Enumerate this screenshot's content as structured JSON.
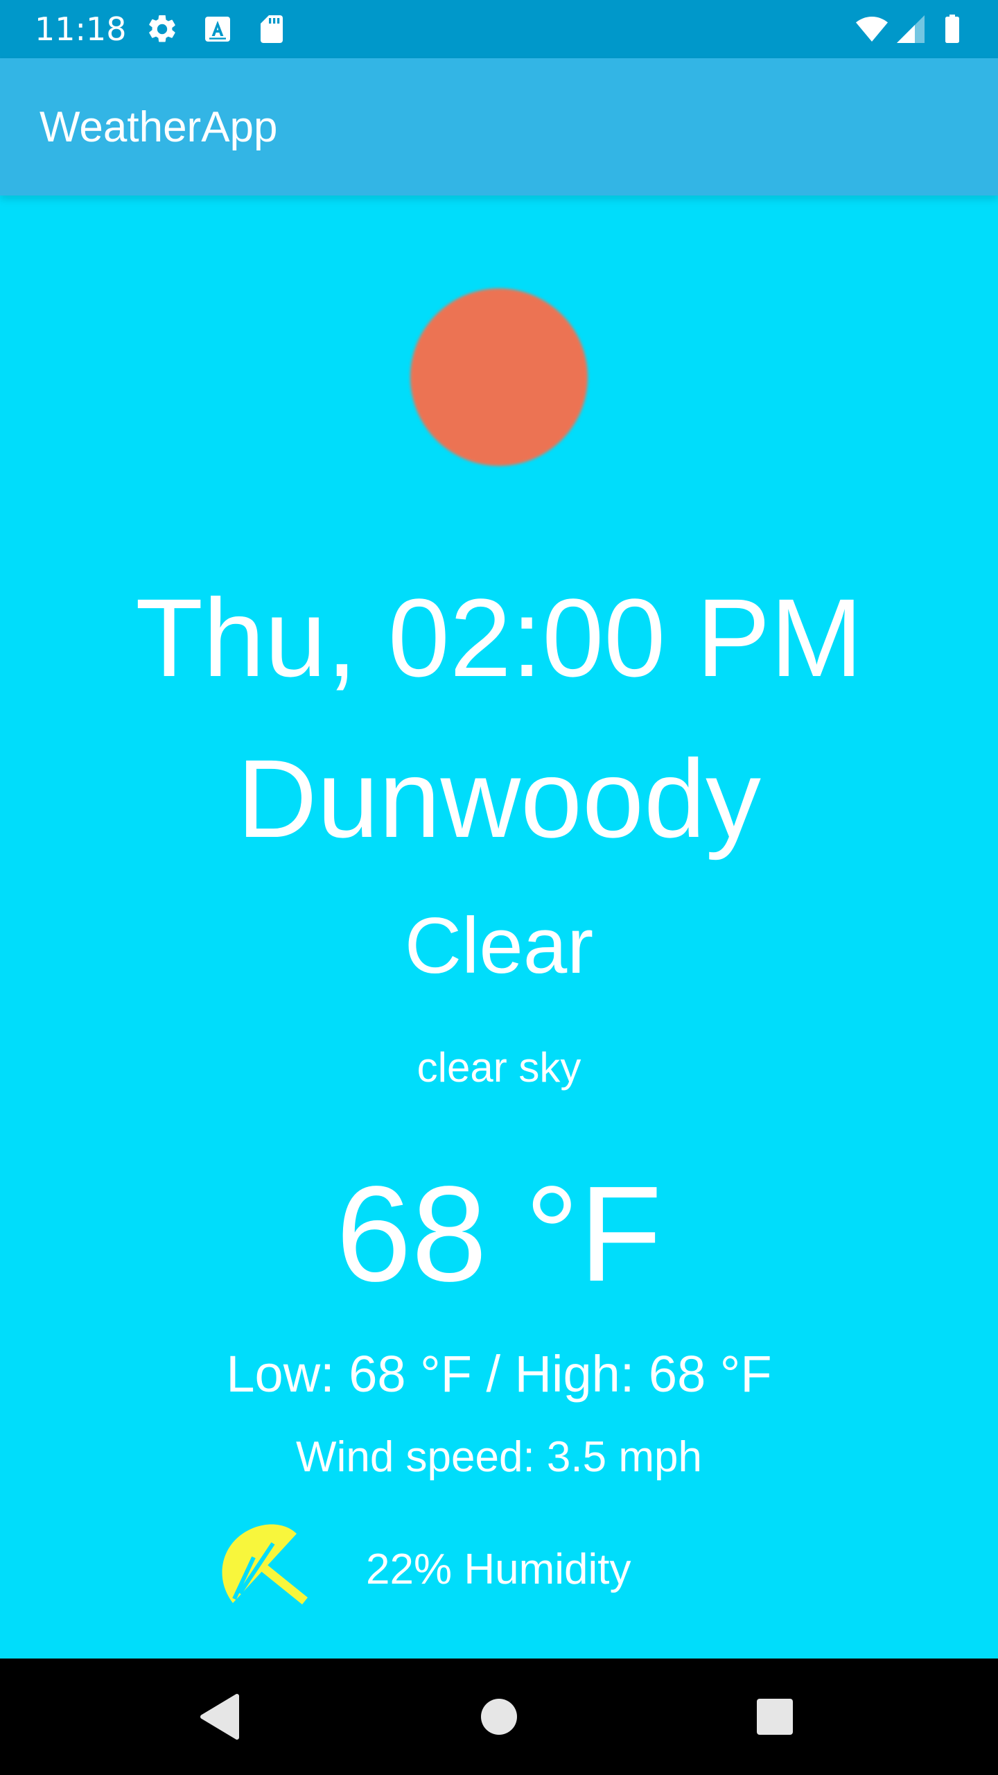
{
  "status_bar": {
    "time": "11:18",
    "icons": [
      "gear-icon",
      "font-a-icon",
      "sd-card-icon",
      "wifi-icon",
      "signal-icon",
      "battery-icon"
    ]
  },
  "app_bar": {
    "title": "WeatherApp"
  },
  "weather": {
    "icon": "sun-icon",
    "date_time": "Thu, 02:00 PM",
    "city": "Dunwoody",
    "condition": "Clear",
    "description": "clear sky",
    "temperature": "68 °F",
    "low_high": "Low: 68 °F / High: 68 °F",
    "wind": "Wind speed: 3.5 mph",
    "humidity": "22% Humidity",
    "humidity_icon": "umbrella-icon"
  },
  "nav_bar": {
    "buttons": [
      "back-icon",
      "home-icon",
      "recents-icon"
    ]
  },
  "colors": {
    "background": "#00DDFB",
    "status_bar": "#0098CA",
    "app_bar": "#33B5E5",
    "sun": "#EC7353",
    "umbrella": "#F8F63C",
    "text": "#FFFFFF",
    "nav_bar": "#000000"
  }
}
